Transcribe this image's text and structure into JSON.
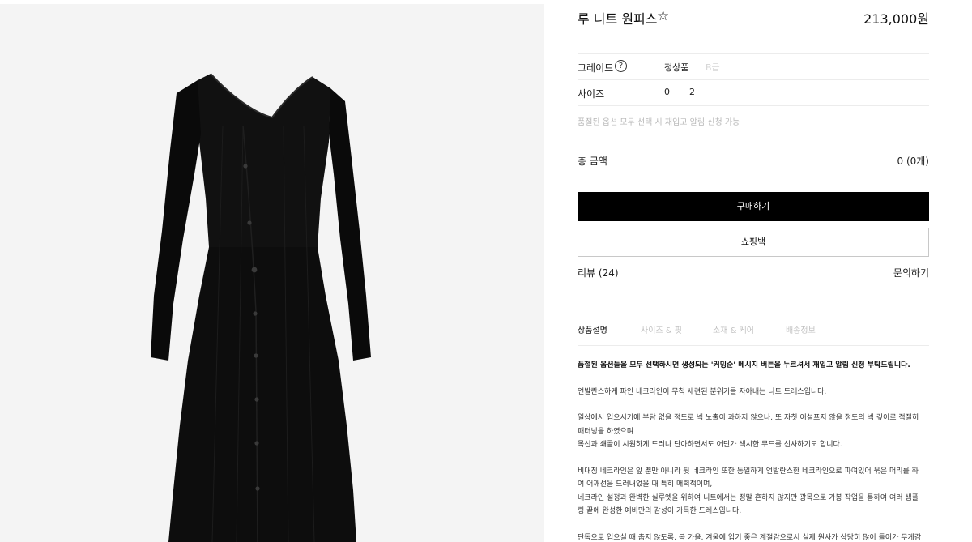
{
  "product": {
    "title": "루 니트 원피스",
    "price": "213,000원",
    "favorite_icon": "star-outline-icon"
  },
  "options": {
    "grade": {
      "label": "그레이드",
      "help_icon": "question-circle-icon",
      "help_glyph": "?",
      "values": [
        "정상품",
        "B급"
      ]
    },
    "size": {
      "label": "사이즈",
      "values": [
        "0",
        "2"
      ]
    },
    "notice": "품절된 옵션 모두 선택 시 재입고 알림 신청 가능"
  },
  "total": {
    "label": "총 금액",
    "value": "0 (0개)"
  },
  "buttons": {
    "buy": "구매하기",
    "bag": "쇼핑백"
  },
  "links": {
    "reviews": "리뷰 (24)",
    "qna": "문의하기"
  },
  "tabs": [
    "상품설명",
    "사이즈 & 핏",
    "소재 & 케어",
    "배송정보"
  ],
  "description": {
    "notice": "품절된 옵션들을 모두 선택하시면 생성되는 '커밍순' 메시지 버튼을 누르셔서 재입고 알림 신청 부탁드립니다.",
    "p1": "언발란스하게 파인 네크라인이 무척 세련된 분위기를 자아내는 니트 드레스입니다.",
    "p2_l1": "일상에서 입으시기에 부담 없을 정도로 넥 노출이 과하지 않으나, 또 자칫 어설프지 않을 정도의 넥 깊이로 적절히",
    "p2_l2": "패터닝을 하였으며",
    "p2_l3": "목선과 쇄골이 시원하게 드러나 단아하면서도 어딘가 섹시한 무드를 선사하기도 합니다.",
    "p3_l1": "비대칭 네크라인은 앞 뿐만 아니라 뒷 네크라인 또한 동일하게 언발란스한 네크라인으로 파여있어 묶은 머리를 하",
    "p3_l2": "여 어깨선을 드러내었을 때 특히 매력적이며,",
    "p3_l3": "네크라인 설정과 완벽한 실루엣을 위하여 니트에서는 정말 흔하지 않지만 광목으로 가봉 작업을 통하여 여러 샘플",
    "p3_l4": "링 끝에 완성한 예비만의 감성이 가득한 드레스입니다.",
    "p4_l1": "단독으로 입으실 때 춥지 않도록, 봄 가을, 겨울에 입기 좋은 계절감으로서 실제 원사가 상당히 많이 들어가 무게감"
  },
  "colors": {
    "image_bg": "#f4f4f4",
    "dress": "#0d0d0d",
    "button_primary": "#000000",
    "muted_text": "#c2c2c2"
  }
}
